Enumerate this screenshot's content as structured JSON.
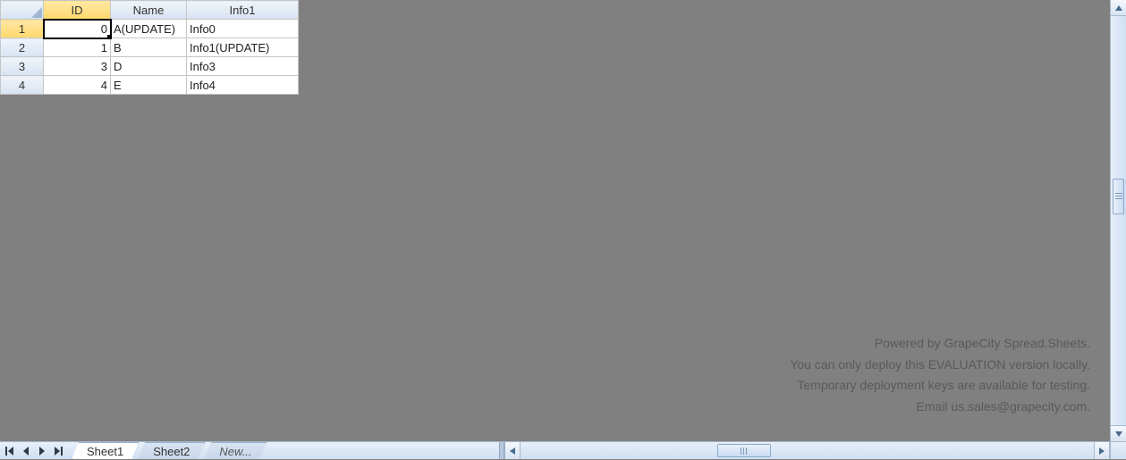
{
  "columns": [
    {
      "key": "id",
      "label": "ID",
      "selected": true,
      "align": "num"
    },
    {
      "key": "name",
      "label": "Name",
      "selected": false,
      "align": "txt"
    },
    {
      "key": "info",
      "label": "Info1",
      "selected": false,
      "align": "txt"
    }
  ],
  "rows": [
    {
      "num": "1",
      "selected": true,
      "cells": {
        "id": "0",
        "name": "A(UPDATE)",
        "info": "Info0"
      }
    },
    {
      "num": "2",
      "selected": false,
      "cells": {
        "id": "1",
        "name": "B",
        "info": "Info1(UPDATE)"
      }
    },
    {
      "num": "3",
      "selected": false,
      "cells": {
        "id": "3",
        "name": "D",
        "info": "Info3"
      }
    },
    {
      "num": "4",
      "selected": false,
      "cells": {
        "id": "4",
        "name": "E",
        "info": "Info4"
      }
    }
  ],
  "active_cell": {
    "row": 0,
    "col": "id"
  },
  "tabs": [
    {
      "label": "Sheet1",
      "active": true,
      "new": false
    },
    {
      "label": "Sheet2",
      "active": false,
      "new": false
    },
    {
      "label": "New...",
      "active": false,
      "new": true
    }
  ],
  "watermark": {
    "l1": "Powered by GrapeCity Spread.Sheets.",
    "l2": "You can only deploy this EVALUATION version locally.",
    "l3": "Temporary deployment keys are available for testing.",
    "l4": "Email us.sales@grapecity.com."
  }
}
